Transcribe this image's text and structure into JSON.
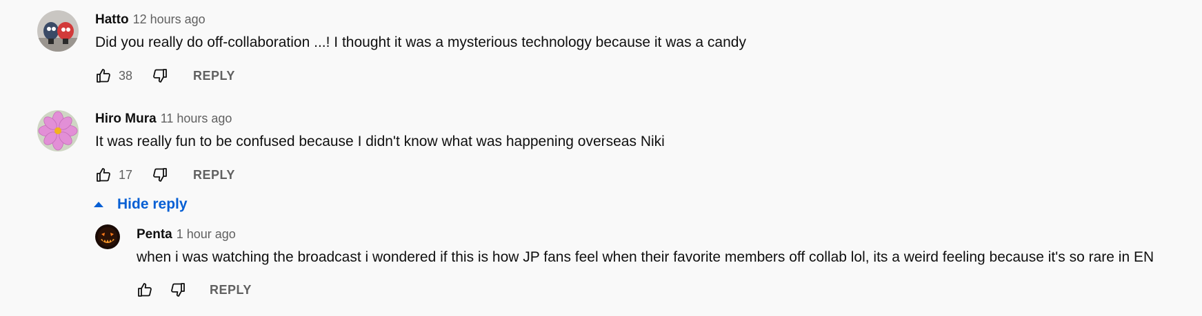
{
  "comments": [
    {
      "author": "Hatto",
      "time": "12 hours ago",
      "text": "Did you really do off-collaboration ...! I thought it was a mysterious technology because it was a candy",
      "likes": "38",
      "reply_label": "REPLY"
    },
    {
      "author": "Hiro Mura",
      "time": "11 hours ago",
      "text": "It was really fun to be confused because I didn't know what was happening overseas Niki",
      "likes": "17",
      "reply_label": "REPLY"
    }
  ],
  "hide_reply_label": "Hide reply",
  "reply": {
    "author": "Penta",
    "time": "1 hour ago",
    "text": "when i was watching the broadcast i wondered if this is how JP fans feel when their favorite members off collab lol, its a weird feeling because it's so rare in EN",
    "reply_label": "REPLY"
  },
  "icons": {
    "like": "thumb-up-icon",
    "dislike": "thumb-down-icon",
    "collapse": "caret-up-icon"
  },
  "colors": {
    "background": "#f9f9f9",
    "link_blue": "#065fd4",
    "secondary_text": "#606060"
  }
}
